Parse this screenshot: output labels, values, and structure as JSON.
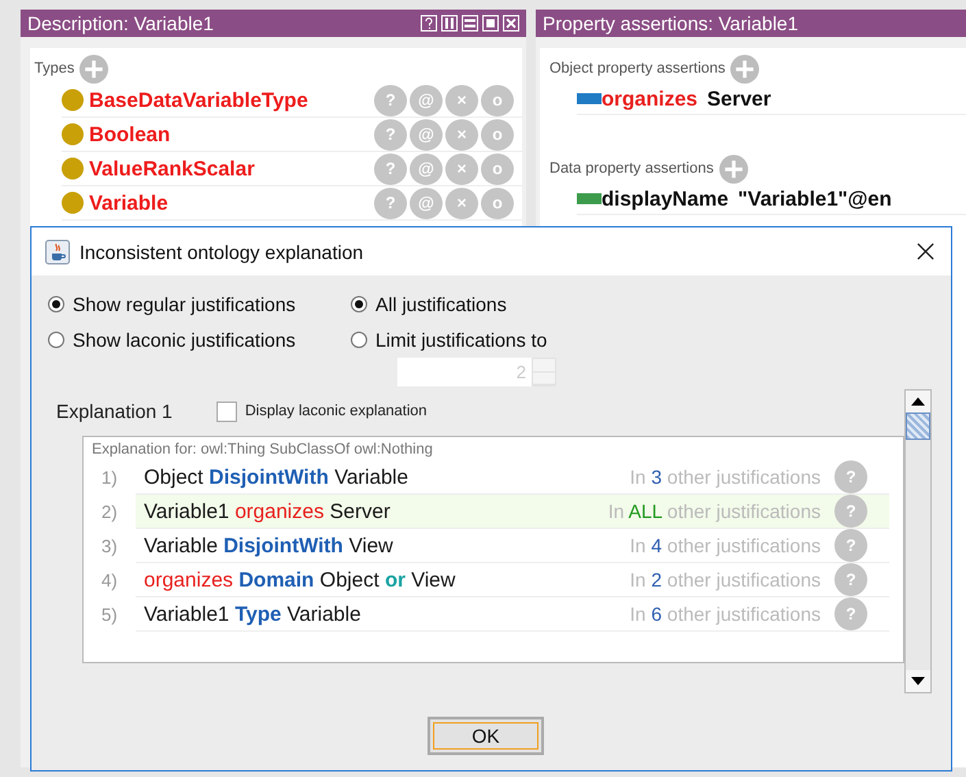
{
  "description_panel": {
    "title": "Description: Variable1",
    "types_label": "Types",
    "types": [
      {
        "name": "BaseDataVariableType",
        "buttons": [
          "?",
          "@",
          "×",
          "o"
        ]
      },
      {
        "name": "Boolean",
        "buttons": [
          "?",
          "@",
          "×",
          "o"
        ]
      },
      {
        "name": "ValueRankScalar",
        "buttons": [
          "?",
          "@",
          "×",
          "o"
        ]
      },
      {
        "name": "Variable",
        "buttons": [
          "?",
          "@",
          "×",
          "o"
        ]
      }
    ]
  },
  "property_panel": {
    "title": "Property assertions: Variable1",
    "sections": [
      {
        "label": "Object property assertions",
        "items": [
          {
            "property": "organizes",
            "kind": "object",
            "value": "Server",
            "color": "#1f7bc4"
          }
        ]
      },
      {
        "label": "Data property assertions",
        "items": [
          {
            "property": "displayName",
            "kind": "data",
            "value": "\"Variable1\"@en",
            "color": "#3c9c4c"
          }
        ]
      }
    ]
  },
  "dialog": {
    "title": "Inconsistent ontology explanation",
    "mode_options": [
      {
        "label": "Show regular justifications",
        "selected": true
      },
      {
        "label": "Show laconic justifications",
        "selected": false
      }
    ],
    "limit_options": [
      {
        "label": "All justifications",
        "selected": true
      },
      {
        "label": "Limit justifications to",
        "selected": false
      }
    ],
    "limit_spinner": {
      "value": "2",
      "disabled": true
    },
    "explanation": {
      "label": "Explanation 1",
      "laconic_checkbox": {
        "label": "Display laconic explanation",
        "checked": false
      },
      "header": "Explanation for: owl:Thing SubClassOf owl:Nothing",
      "rows": [
        {
          "number": "1)",
          "parts": [
            {
              "text": "Object",
              "kind": "entity"
            },
            {
              "text": "DisjointWith",
              "kind": "keyword"
            },
            {
              "text": "Variable",
              "kind": "entity"
            }
          ],
          "prefix": "In",
          "count": "3",
          "suffix": "other justifications",
          "all": false,
          "help": "?"
        },
        {
          "number": "2)",
          "parts": [
            {
              "text": "Variable1",
              "kind": "entity"
            },
            {
              "text": "organizes",
              "kind": "property"
            },
            {
              "text": "Server",
              "kind": "entity"
            }
          ],
          "prefix": "In",
          "count": "ALL",
          "suffix": "other justifications",
          "all": true,
          "help": "?"
        },
        {
          "number": "3)",
          "parts": [
            {
              "text": "Variable",
              "kind": "entity"
            },
            {
              "text": "DisjointWith",
              "kind": "keyword"
            },
            {
              "text": "View",
              "kind": "entity"
            }
          ],
          "prefix": "In",
          "count": "4",
          "suffix": "other justifications",
          "all": false,
          "help": "?"
        },
        {
          "number": "4)",
          "parts": [
            {
              "text": "organizes",
              "kind": "property"
            },
            {
              "text": "Domain",
              "kind": "keyword"
            },
            {
              "text": "Object",
              "kind": "entity"
            },
            {
              "text": "or",
              "kind": "operator"
            },
            {
              "text": "View",
              "kind": "entity"
            }
          ],
          "prefix": "In",
          "count": "2",
          "suffix": "other justifications",
          "all": false,
          "help": "?"
        },
        {
          "number": "5)",
          "parts": [
            {
              "text": "Variable1",
              "kind": "entity"
            },
            {
              "text": "Type",
              "kind": "keyword"
            },
            {
              "text": "Variable",
              "kind": "entity"
            }
          ],
          "prefix": "In",
          "count": "6",
          "suffix": "other justifications",
          "all": false,
          "help": "?"
        }
      ]
    },
    "ok_button": "OK"
  }
}
